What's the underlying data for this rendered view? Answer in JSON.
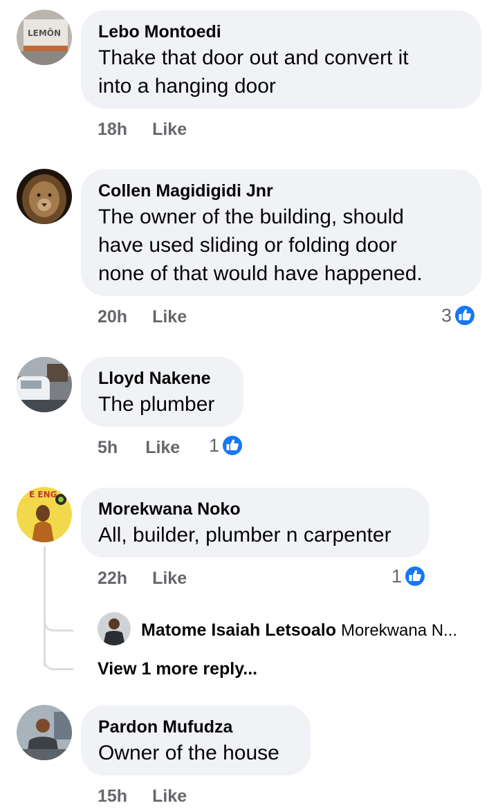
{
  "comments": [
    {
      "author": "Lebo Montoedi",
      "lines": [
        "Thake that door out and convert it",
        "into a hanging door"
      ],
      "time": "18h",
      "like_label": "Like",
      "avatar_text": "LEMÔN"
    },
    {
      "author": "Collen Magidigidi Jnr",
      "lines": [
        "The owner of the building, should",
        "have used sliding or folding door",
        "none of that would have happened."
      ],
      "time": "20h",
      "like_label": "Like",
      "reactions": "3"
    },
    {
      "author": "Lloyd Nakene",
      "lines": [
        "The plumber"
      ],
      "time": "5h",
      "like_label": "Like",
      "reactions": "1"
    },
    {
      "author": "Morekwana Noko",
      "lines": [
        "All, builder, plumber n carpenter"
      ],
      "time": "22h",
      "like_label": "Like",
      "reactions": "1",
      "avatar_text": "E ENG"
    },
    {
      "author": "Pardon Mufudza",
      "lines": [
        "Owner of the house"
      ],
      "time": "15h",
      "like_label": "Like"
    }
  ],
  "reply_preview": {
    "author": "Matome Isaiah Letsoalo",
    "text": "Morekwana N..."
  },
  "view_more_replies": "View 1 more reply...",
  "colors": {
    "bubble": "#f0f2f5",
    "secondary_text": "#65676b",
    "like_blue": "#1877f2",
    "thread_line": "#dadde1"
  }
}
